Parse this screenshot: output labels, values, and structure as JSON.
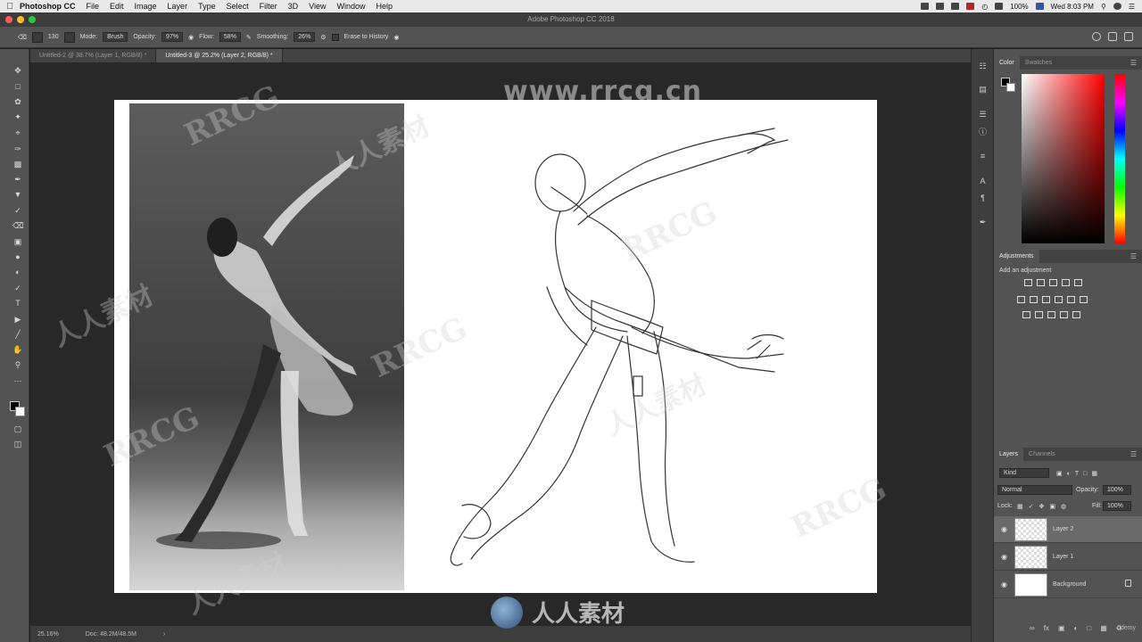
{
  "menubar": {
    "app_name": "Photoshop CC",
    "items": [
      "File",
      "Edit",
      "Image",
      "Layer",
      "Type",
      "Select",
      "Filter",
      "3D",
      "View",
      "Window",
      "Help"
    ],
    "battery": "100%",
    "clock": "Wed 8:03 PM"
  },
  "window": {
    "title": "Adobe Photoshop CC 2018"
  },
  "options": {
    "brush_size": "130",
    "mode_label": "Mode:",
    "mode_value": "Brush",
    "opacity_label": "Opacity:",
    "opacity_value": "97%",
    "flow_label": "Flow:",
    "flow_value": "58%",
    "smoothing_label": "Smoothing:",
    "smoothing_value": "26%",
    "erase_history": "Erase to History"
  },
  "tabs": [
    {
      "label": "Untitled-2 @ 38.7% (Layer 1, RGB/8) *",
      "active": false
    },
    {
      "label": "Untitled-3 @ 25.2% (Layer 2, RGB/8) *",
      "active": true
    }
  ],
  "status": {
    "zoom": "25.16%",
    "doc": "Doc: 48.2M/48.5M"
  },
  "color_panel": {
    "tabs": [
      "Color",
      "Swatches"
    ],
    "hue_color": "#ff0000"
  },
  "adjustments": {
    "title": "Adjustments",
    "subtitle": "Add an adjustment"
  },
  "layers_panel": {
    "tabs": [
      "Layers",
      "Channels"
    ],
    "filter": "Kind",
    "blend_mode": "Normal",
    "opacity_label": "Opacity:",
    "opacity_value": "100%",
    "lock_label": "Lock:",
    "fill_label": "Fill:",
    "fill_value": "100%",
    "layers": [
      {
        "name": "Layer 2",
        "selected": true
      },
      {
        "name": "Layer 1",
        "selected": false
      },
      {
        "name": "Background",
        "selected": false,
        "locked": true
      }
    ]
  },
  "watermark": {
    "url": "www.rrcg.cn",
    "brand": "RRCG",
    "cn": "人人素材"
  },
  "udemy": "udemy"
}
